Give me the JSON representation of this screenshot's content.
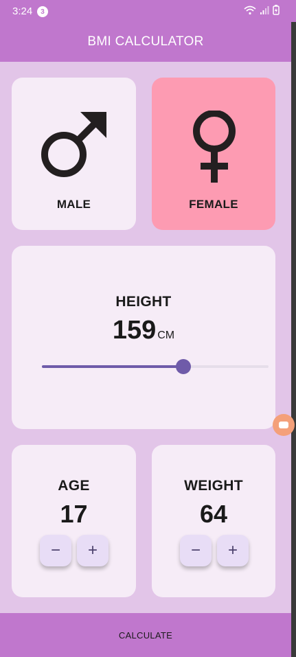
{
  "status_bar": {
    "time": "3:24",
    "notification_count": "3"
  },
  "app_bar": {
    "title": "BMI CALCULATOR"
  },
  "gender": {
    "male_label": "MALE",
    "female_label": "FEMALE",
    "selected": "female",
    "male_icon": "male-symbol-icon",
    "female_icon": "female-symbol-icon"
  },
  "height": {
    "label": "HEIGHT",
    "value": "159",
    "unit": "CM",
    "slider_fraction": 0.625
  },
  "age": {
    "label": "AGE",
    "value": "17",
    "minus": "−",
    "plus": "+"
  },
  "weight": {
    "label": "WEIGHT",
    "value": "64",
    "minus": "−",
    "plus": "+"
  },
  "calculate_button": {
    "label": "CALCULATE"
  },
  "colors": {
    "primary": "#c077cd",
    "background": "#e2c5e8",
    "card": "#f6ecf7",
    "selected_card": "#fd9bb2",
    "slider": "#6f5ba9",
    "stepper": "#e8ddf6"
  }
}
